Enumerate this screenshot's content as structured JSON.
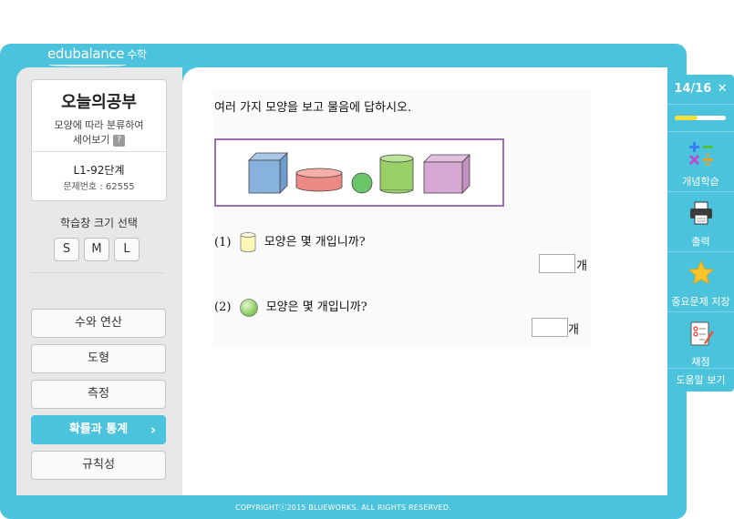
{
  "brand": {
    "logo_text": "edubalance",
    "logo_sub": "수학"
  },
  "lesson": {
    "title": "오늘의공부",
    "subtitle_line1": "모양에 따라 분류하여",
    "subtitle_line2": "세어보기",
    "help_icon": "?",
    "step": "L1-92단계",
    "problem_no": "문제번호 : 62555"
  },
  "size_select": {
    "label": "학습창 크기 선택",
    "options": [
      "S",
      "M",
      "L"
    ]
  },
  "menu": [
    {
      "label": "수와 연산",
      "active": false
    },
    {
      "label": "도형",
      "active": false
    },
    {
      "label": "측정",
      "active": false
    },
    {
      "label": "확률과 통계",
      "active": true
    },
    {
      "label": "규칙성",
      "active": false
    }
  ],
  "question": {
    "instruction": "여러 가지 모양을 보고 물음에 답하시오.",
    "shapes": [
      "cube",
      "cylinder-flat",
      "sphere",
      "cylinder-tall",
      "cube"
    ],
    "items": [
      {
        "num": "(1)",
        "icon": "cylinder-icon",
        "text": "모양은 몇 개입니까?",
        "unit": "개",
        "answer": ""
      },
      {
        "num": "(2)",
        "icon": "sphere-icon",
        "text": "모양은 몇 개입니까?",
        "unit": "개",
        "answer": ""
      }
    ]
  },
  "right_panel": {
    "counter": "14/16",
    "progress": 0.45,
    "tools": [
      {
        "label": "개념학습",
        "icon": "math-operators-icon"
      },
      {
        "label": "출력",
        "icon": "printer-icon"
      },
      {
        "label": "중요문제 저장",
        "icon": "star-icon"
      },
      {
        "label": "채점",
        "icon": "grading-icon"
      }
    ],
    "help_label": "도움말 보기"
  },
  "footer": {
    "copyright": "COPYRIGHTⓒ2015 BLUEWORKS. ALL RIGHTS RESERVED."
  },
  "colors": {
    "accent": "#4bc3dc",
    "progress": "#f7e23b",
    "frame_purple": "#9b6fb4"
  }
}
